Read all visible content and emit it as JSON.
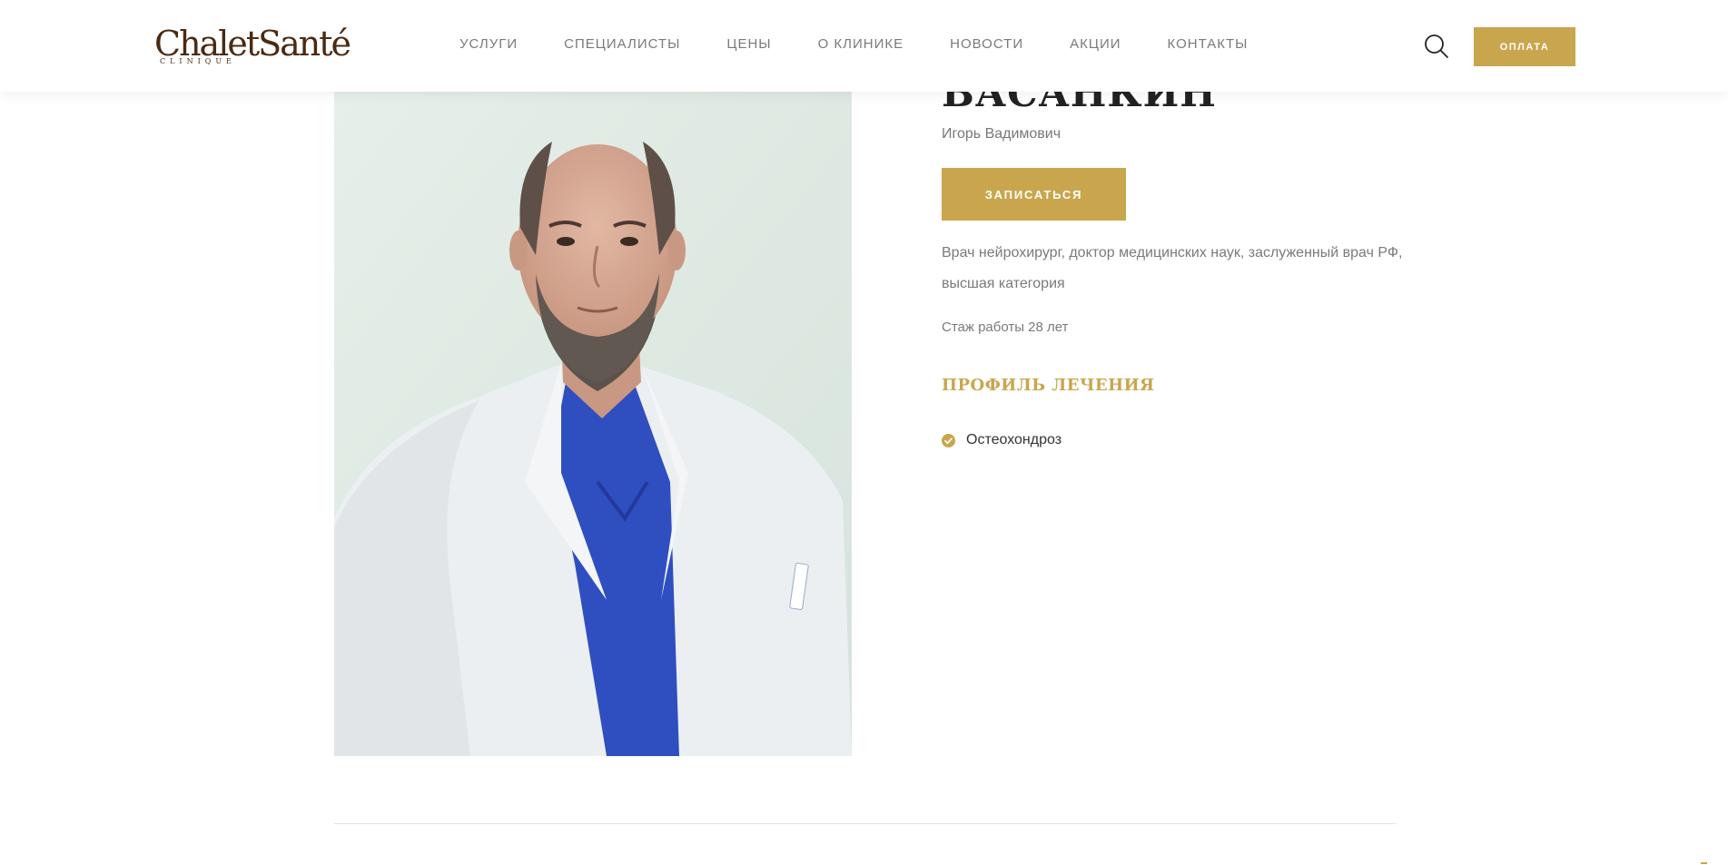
{
  "header": {
    "logo": {
      "main": "ChaletSanté",
      "sub": "CLINIQUE"
    },
    "nav": [
      {
        "label": "УСЛУГИ"
      },
      {
        "label": "СПЕЦИАЛИСТЫ"
      },
      {
        "label": "ЦЕНЫ"
      },
      {
        "label": "О КЛИНИКЕ"
      },
      {
        "label": "НОВОСТИ"
      },
      {
        "label": "АКЦИИ"
      },
      {
        "label": "КОНТАКТЫ"
      }
    ],
    "search_icon": "search-icon",
    "pay_label": "ОПЛАТА"
  },
  "doctor": {
    "surname": "БАСАНКИН",
    "given_names": "Игорь Вадимович",
    "book_label": "ЗАПИСАТЬСЯ",
    "description": "Врач нейрохирург, доктор медицинских наук, заслуженный врач РФ, высшая категория",
    "experience": "Стаж работы 28 лет",
    "profile_heading": "ПРОФИЛЬ ЛЕЧЕНИЯ",
    "profile_items": [
      {
        "label": "Остеохондроз",
        "icon": "check-circle-icon"
      }
    ]
  },
  "colors": {
    "accent": "#c9a64d",
    "logo": "#4a2a12",
    "muted_text": "#7a7a7a"
  }
}
